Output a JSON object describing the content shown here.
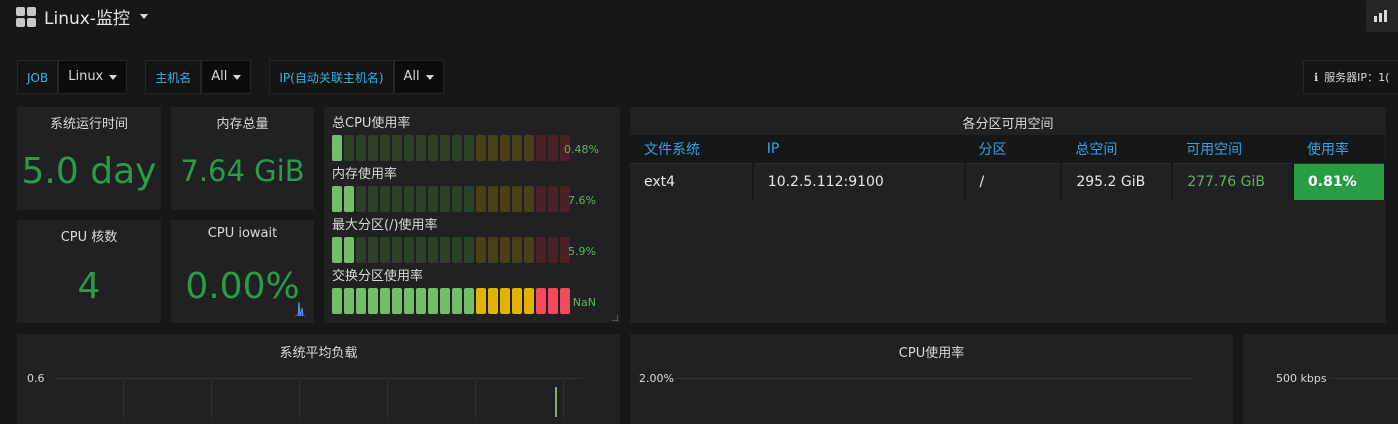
{
  "header": {
    "title": "Linux-监控"
  },
  "variables": [
    {
      "label": "JOB",
      "value": "Linux"
    },
    {
      "label": "主机名",
      "value": "All"
    },
    {
      "label": "IP(自动关联主机名)",
      "value": "All"
    }
  ],
  "server_ip": {
    "label": "服务器IP：1("
  },
  "stats": {
    "uptime": {
      "title": "系统运行时间",
      "value": "5.0 day"
    },
    "mem_total": {
      "title": "内存总量",
      "value": "7.64 GiB"
    },
    "cpu_cores": {
      "title": "CPU 核数",
      "value": "4"
    },
    "cpu_iowait": {
      "title": "CPU iowait",
      "value": "0.00%"
    }
  },
  "gauges": [
    {
      "label": "总CPU使用率",
      "value_text": "0.48%",
      "percent": 0.48
    },
    {
      "label": "内存使用率",
      "value_text": "7.6%",
      "percent": 7.6
    },
    {
      "label": "最大分区(/)使用率",
      "value_text": "5.9%",
      "percent": 5.9
    },
    {
      "label": "交换分区使用率",
      "value_text": "NaN",
      "percent": 100
    }
  ],
  "disk_table": {
    "title": "各分区可用空间",
    "columns": [
      "文件系统",
      "IP",
      "分区",
      "总空间",
      "可用空间",
      "使用率"
    ],
    "rows": [
      [
        "ext4",
        "10.2.5.112:9100",
        "/",
        "295.2 GiB",
        "277.76 GiB",
        "0.81%"
      ]
    ]
  },
  "load_panel": {
    "title": "系统平均负载",
    "y_tick": "0.6"
  },
  "cpu_panel": {
    "title": "CPU使用率",
    "y_tick": "2.00%"
  },
  "net_panel": {
    "y_tick": "500 kbps"
  },
  "colors": {
    "green": "#299c46",
    "blue": "#33a2e5",
    "panel": "#212124",
    "bg": "#161719"
  }
}
